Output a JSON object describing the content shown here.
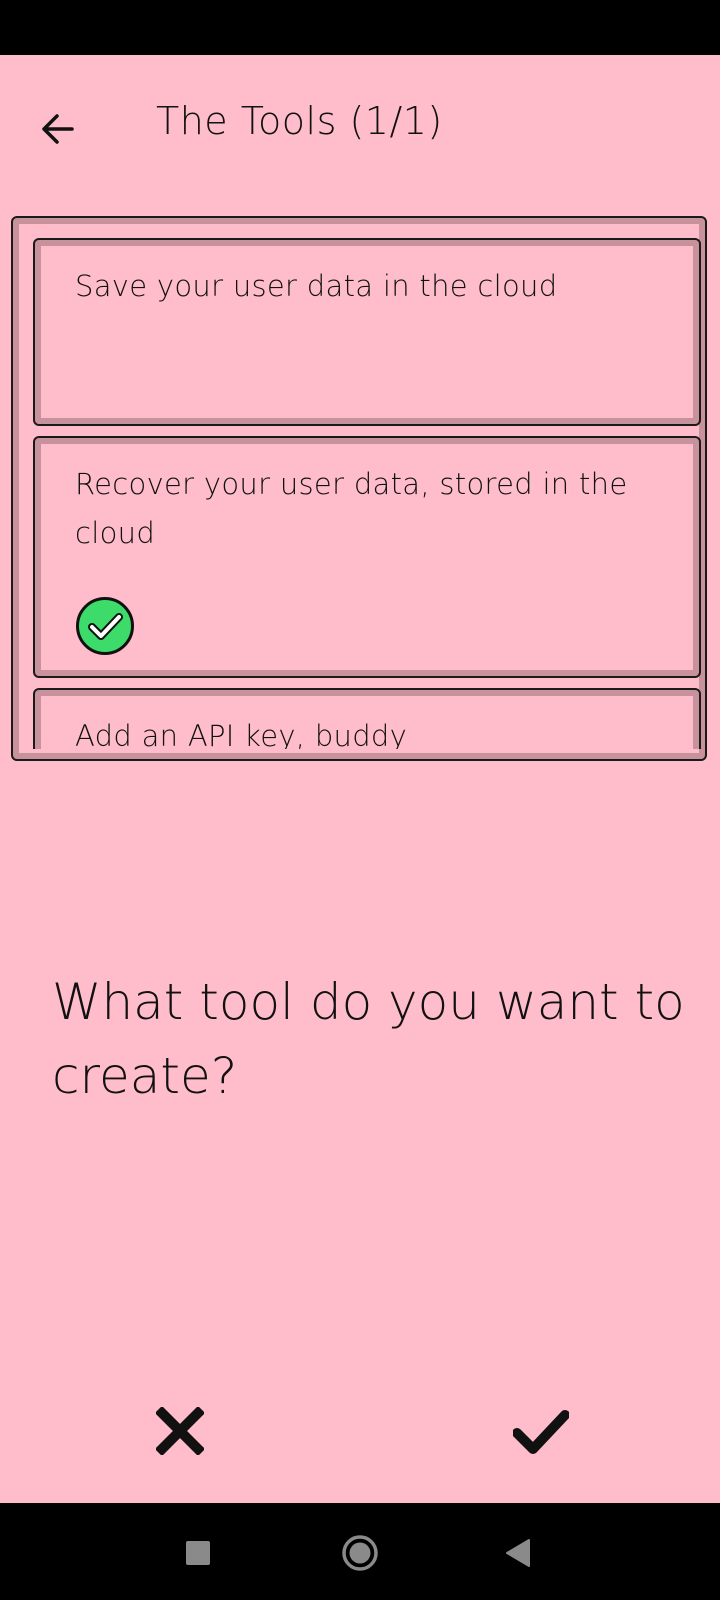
{
  "header": {
    "title": "The Tools (1/1)",
    "back_icon": "arrow-left-icon"
  },
  "tools": [
    {
      "label": "Save your user data in the cloud",
      "selected": false
    },
    {
      "label": "Recover your user data, stored in the cloud",
      "selected": true,
      "badge_icon": "check-circle-icon",
      "badge_color": "#3ddc6a"
    },
    {
      "label": "Add an API key, buddy",
      "selected": false
    }
  ],
  "prompt": {
    "question": "What tool do you want to create?"
  },
  "actions": {
    "cancel_icon": "close-icon",
    "confirm_icon": "checkmark-icon"
  },
  "system_nav": {
    "recents_icon": "square-icon",
    "home_icon": "circle-icon",
    "back_icon": "triangle-back-icon"
  },
  "colors": {
    "background": "#ffbccb",
    "card_inset": "#c8929c",
    "badge_green": "#3ddc6a"
  }
}
